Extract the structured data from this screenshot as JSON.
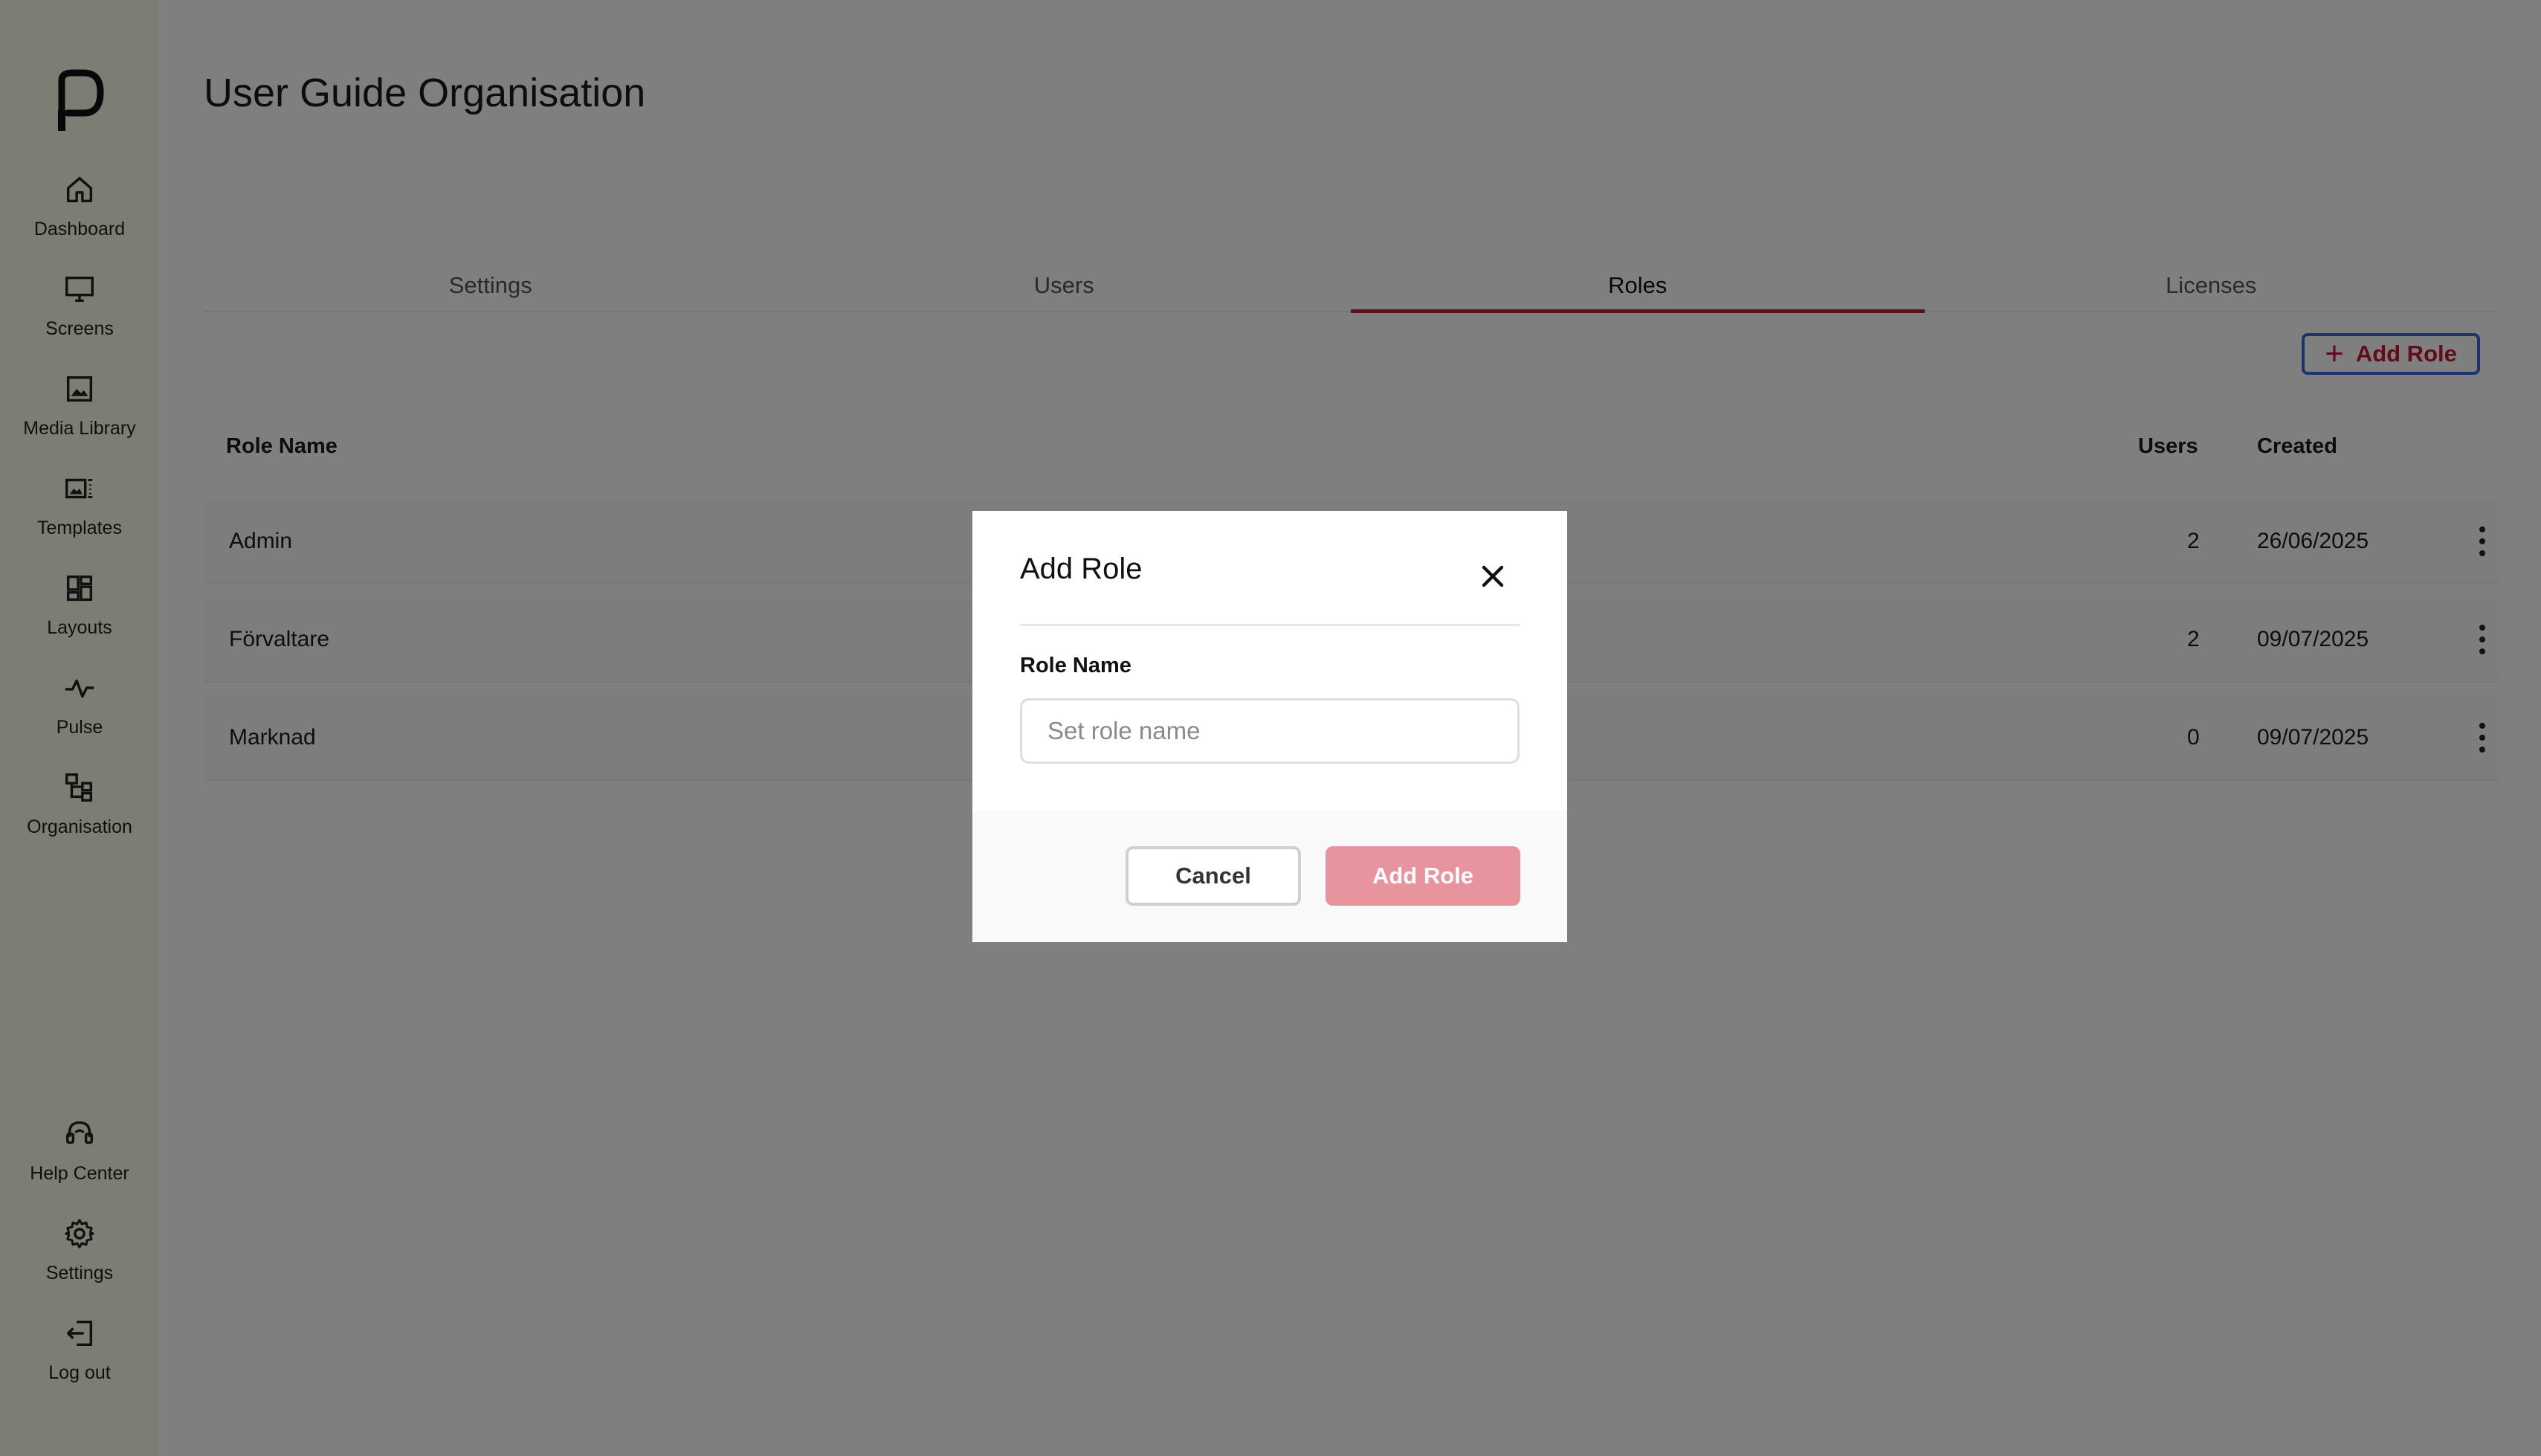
{
  "sidebar": {
    "items": [
      {
        "label": "Dashboard",
        "icon": "home-icon"
      },
      {
        "label": "Screens",
        "icon": "monitor-icon"
      },
      {
        "label": "Media Library",
        "icon": "image-icon"
      },
      {
        "label": "Templates",
        "icon": "template-icon"
      },
      {
        "label": "Layouts",
        "icon": "layout-grid-icon"
      },
      {
        "label": "Pulse",
        "icon": "pulse-icon"
      },
      {
        "label": "Organisation",
        "icon": "org-chart-icon"
      }
    ],
    "bottom_items": [
      {
        "label": "Help Center",
        "icon": "headset-icon"
      },
      {
        "label": "Settings",
        "icon": "gear-icon"
      },
      {
        "label": "Log out",
        "icon": "logout-icon"
      }
    ]
  },
  "page": {
    "title": "User Guide Organisation"
  },
  "tabs": [
    {
      "label": "Settings",
      "active": false
    },
    {
      "label": "Users",
      "active": false
    },
    {
      "label": "Roles",
      "active": true
    },
    {
      "label": "Licenses",
      "active": false
    }
  ],
  "toolbar": {
    "add_role_label": "Add Role"
  },
  "table": {
    "columns": {
      "role_name": "Role Name",
      "users": "Users",
      "created": "Created"
    },
    "rows": [
      {
        "role_name": "Admin",
        "users": "2",
        "created": "26/06/2025"
      },
      {
        "role_name": "Förvaltare",
        "users": "2",
        "created": "09/07/2025"
      },
      {
        "role_name": "Marknad",
        "users": "0",
        "created": "09/07/2025"
      }
    ]
  },
  "modal": {
    "title": "Add Role",
    "field_label": "Role Name",
    "input_value": "",
    "input_placeholder": "Set role name",
    "cancel_label": "Cancel",
    "submit_label": "Add Role"
  },
  "colors": {
    "accent": "#c21a33",
    "sidebar_bg": "#fdfae6",
    "submit_disabled": "#e8949f",
    "focus_outline": "#3c66d9"
  }
}
